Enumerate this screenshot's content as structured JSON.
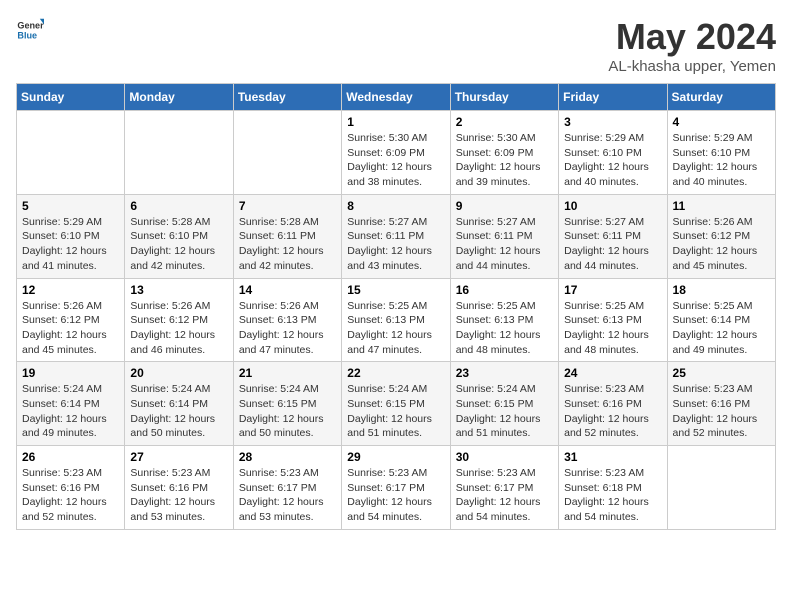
{
  "logo": {
    "general": "General",
    "blue": "Blue"
  },
  "header": {
    "title": "May 2024",
    "subtitle": "AL-khasha upper, Yemen"
  },
  "weekdays": [
    "Sunday",
    "Monday",
    "Tuesday",
    "Wednesday",
    "Thursday",
    "Friday",
    "Saturday"
  ],
  "weeks": [
    [
      {
        "day": "",
        "sunrise": "",
        "sunset": "",
        "daylight": ""
      },
      {
        "day": "",
        "sunrise": "",
        "sunset": "",
        "daylight": ""
      },
      {
        "day": "",
        "sunrise": "",
        "sunset": "",
        "daylight": ""
      },
      {
        "day": "1",
        "sunrise": "Sunrise: 5:30 AM",
        "sunset": "Sunset: 6:09 PM",
        "daylight": "Daylight: 12 hours and 38 minutes."
      },
      {
        "day": "2",
        "sunrise": "Sunrise: 5:30 AM",
        "sunset": "Sunset: 6:09 PM",
        "daylight": "Daylight: 12 hours and 39 minutes."
      },
      {
        "day": "3",
        "sunrise": "Sunrise: 5:29 AM",
        "sunset": "Sunset: 6:10 PM",
        "daylight": "Daylight: 12 hours and 40 minutes."
      },
      {
        "day": "4",
        "sunrise": "Sunrise: 5:29 AM",
        "sunset": "Sunset: 6:10 PM",
        "daylight": "Daylight: 12 hours and 40 minutes."
      }
    ],
    [
      {
        "day": "5",
        "sunrise": "Sunrise: 5:29 AM",
        "sunset": "Sunset: 6:10 PM",
        "daylight": "Daylight: 12 hours and 41 minutes."
      },
      {
        "day": "6",
        "sunrise": "Sunrise: 5:28 AM",
        "sunset": "Sunset: 6:10 PM",
        "daylight": "Daylight: 12 hours and 42 minutes."
      },
      {
        "day": "7",
        "sunrise": "Sunrise: 5:28 AM",
        "sunset": "Sunset: 6:11 PM",
        "daylight": "Daylight: 12 hours and 42 minutes."
      },
      {
        "day": "8",
        "sunrise": "Sunrise: 5:27 AM",
        "sunset": "Sunset: 6:11 PM",
        "daylight": "Daylight: 12 hours and 43 minutes."
      },
      {
        "day": "9",
        "sunrise": "Sunrise: 5:27 AM",
        "sunset": "Sunset: 6:11 PM",
        "daylight": "Daylight: 12 hours and 44 minutes."
      },
      {
        "day": "10",
        "sunrise": "Sunrise: 5:27 AM",
        "sunset": "Sunset: 6:11 PM",
        "daylight": "Daylight: 12 hours and 44 minutes."
      },
      {
        "day": "11",
        "sunrise": "Sunrise: 5:26 AM",
        "sunset": "Sunset: 6:12 PM",
        "daylight": "Daylight: 12 hours and 45 minutes."
      }
    ],
    [
      {
        "day": "12",
        "sunrise": "Sunrise: 5:26 AM",
        "sunset": "Sunset: 6:12 PM",
        "daylight": "Daylight: 12 hours and 45 minutes."
      },
      {
        "day": "13",
        "sunrise": "Sunrise: 5:26 AM",
        "sunset": "Sunset: 6:12 PM",
        "daylight": "Daylight: 12 hours and 46 minutes."
      },
      {
        "day": "14",
        "sunrise": "Sunrise: 5:26 AM",
        "sunset": "Sunset: 6:13 PM",
        "daylight": "Daylight: 12 hours and 47 minutes."
      },
      {
        "day": "15",
        "sunrise": "Sunrise: 5:25 AM",
        "sunset": "Sunset: 6:13 PM",
        "daylight": "Daylight: 12 hours and 47 minutes."
      },
      {
        "day": "16",
        "sunrise": "Sunrise: 5:25 AM",
        "sunset": "Sunset: 6:13 PM",
        "daylight": "Daylight: 12 hours and 48 minutes."
      },
      {
        "day": "17",
        "sunrise": "Sunrise: 5:25 AM",
        "sunset": "Sunset: 6:13 PM",
        "daylight": "Daylight: 12 hours and 48 minutes."
      },
      {
        "day": "18",
        "sunrise": "Sunrise: 5:25 AM",
        "sunset": "Sunset: 6:14 PM",
        "daylight": "Daylight: 12 hours and 49 minutes."
      }
    ],
    [
      {
        "day": "19",
        "sunrise": "Sunrise: 5:24 AM",
        "sunset": "Sunset: 6:14 PM",
        "daylight": "Daylight: 12 hours and 49 minutes."
      },
      {
        "day": "20",
        "sunrise": "Sunrise: 5:24 AM",
        "sunset": "Sunset: 6:14 PM",
        "daylight": "Daylight: 12 hours and 50 minutes."
      },
      {
        "day": "21",
        "sunrise": "Sunrise: 5:24 AM",
        "sunset": "Sunset: 6:15 PM",
        "daylight": "Daylight: 12 hours and 50 minutes."
      },
      {
        "day": "22",
        "sunrise": "Sunrise: 5:24 AM",
        "sunset": "Sunset: 6:15 PM",
        "daylight": "Daylight: 12 hours and 51 minutes."
      },
      {
        "day": "23",
        "sunrise": "Sunrise: 5:24 AM",
        "sunset": "Sunset: 6:15 PM",
        "daylight": "Daylight: 12 hours and 51 minutes."
      },
      {
        "day": "24",
        "sunrise": "Sunrise: 5:23 AM",
        "sunset": "Sunset: 6:16 PM",
        "daylight": "Daylight: 12 hours and 52 minutes."
      },
      {
        "day": "25",
        "sunrise": "Sunrise: 5:23 AM",
        "sunset": "Sunset: 6:16 PM",
        "daylight": "Daylight: 12 hours and 52 minutes."
      }
    ],
    [
      {
        "day": "26",
        "sunrise": "Sunrise: 5:23 AM",
        "sunset": "Sunset: 6:16 PM",
        "daylight": "Daylight: 12 hours and 52 minutes."
      },
      {
        "day": "27",
        "sunrise": "Sunrise: 5:23 AM",
        "sunset": "Sunset: 6:16 PM",
        "daylight": "Daylight: 12 hours and 53 minutes."
      },
      {
        "day": "28",
        "sunrise": "Sunrise: 5:23 AM",
        "sunset": "Sunset: 6:17 PM",
        "daylight": "Daylight: 12 hours and 53 minutes."
      },
      {
        "day": "29",
        "sunrise": "Sunrise: 5:23 AM",
        "sunset": "Sunset: 6:17 PM",
        "daylight": "Daylight: 12 hours and 54 minutes."
      },
      {
        "day": "30",
        "sunrise": "Sunrise: 5:23 AM",
        "sunset": "Sunset: 6:17 PM",
        "daylight": "Daylight: 12 hours and 54 minutes."
      },
      {
        "day": "31",
        "sunrise": "Sunrise: 5:23 AM",
        "sunset": "Sunset: 6:18 PM",
        "daylight": "Daylight: 12 hours and 54 minutes."
      },
      {
        "day": "",
        "sunrise": "",
        "sunset": "",
        "daylight": ""
      }
    ]
  ]
}
